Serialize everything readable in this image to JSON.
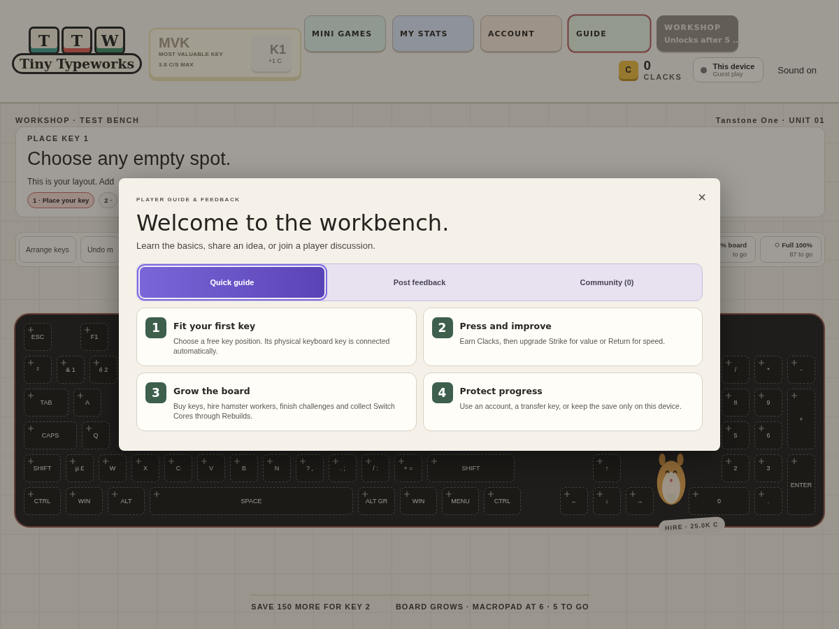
{
  "logo": {
    "keys": [
      "T",
      "T",
      "W"
    ],
    "name": "Tiny Typeworks"
  },
  "mvk": {
    "title": "MVK",
    "subtitle": "MOST VALUABLE KEY",
    "rate": "3.8 C/S MAX",
    "key": "K1",
    "key_value": "+1 C"
  },
  "nav": [
    {
      "label": "MINI GAMES",
      "selected": false,
      "disabled": false
    },
    {
      "label": "MY STATS",
      "selected": false,
      "disabled": false
    },
    {
      "label": "ACCOUNT",
      "selected": false,
      "disabled": false
    },
    {
      "label": "GUIDE",
      "selected": true,
      "disabled": false
    },
    {
      "label": "WORKSHOP",
      "sublabel": "Unlocks after 5 ...",
      "selected": false,
      "disabled": true
    }
  ],
  "status": {
    "coin": "C",
    "clacks": "0",
    "clacks_label": "CLACKS",
    "device": "This device",
    "device_sub": "Guest play",
    "sound": "Sound on"
  },
  "bench": {
    "left_label": "WORKSHOP · TEST BENCH",
    "right_label": "Tanstone One · UNIT 01"
  },
  "place_card": {
    "eyebrow": "PLACE KEY 1",
    "heading": "Choose any empty spot.",
    "text": "This is your layout. Add",
    "steps": [
      {
        "label": "1 · Place your key",
        "selected": true
      },
      {
        "label": "2 ·",
        "selected": false
      }
    ]
  },
  "toolbar": {
    "buttons": [
      "Arrange keys",
      "Undo m"
    ],
    "goals": [
      {
        "title": "% board",
        "sub": "to go"
      },
      {
        "title": "Full 100%",
        "sub": "87 to go",
        "icon": true
      }
    ]
  },
  "keyboard": {
    "rows": [
      {
        "main": [
          {
            "label": "ESC",
            "kind": "esc"
          },
          {
            "label": "F1",
            "kind": "key"
          }
        ],
        "nav": [],
        "pad": []
      },
      {
        "main": [
          {
            "label": "²",
            "kind": "key"
          },
          {
            "label": "& 1",
            "kind": "key"
          },
          {
            "label": "é 2",
            "kind": "key"
          }
        ],
        "nav": [],
        "pad": [
          {
            "label": "/",
            "kind": "key"
          },
          {
            "label": "*",
            "kind": "key"
          },
          {
            "label": "-",
            "kind": "key"
          }
        ]
      },
      {
        "main": [
          {
            "label": "TAB",
            "kind": "tab"
          },
          {
            "label": "A",
            "kind": "key"
          }
        ],
        "nav": [],
        "pad": [
          {
            "label": "8",
            "kind": "key"
          },
          {
            "label": "9",
            "kind": "key"
          },
          {
            "label": "+",
            "kind": "tall"
          }
        ]
      },
      {
        "main": [
          {
            "label": "CAPS",
            "kind": "caps"
          },
          {
            "label": "Q",
            "kind": "key"
          }
        ],
        "nav": [],
        "pad": [
          {
            "label": "5",
            "kind": "key"
          },
          {
            "label": "6",
            "kind": "key"
          }
        ]
      },
      {
        "main": [
          {
            "label": "SHIFT",
            "kind": "mod"
          },
          {
            "label": "µ £",
            "kind": "key"
          },
          {
            "label": "W",
            "kind": "key"
          },
          {
            "label": "X",
            "kind": "key"
          },
          {
            "label": "C",
            "kind": "key"
          },
          {
            "label": "V",
            "kind": "key"
          },
          {
            "label": "B",
            "kind": "key"
          },
          {
            "label": "N",
            "kind": "key"
          },
          {
            "label": "? ,",
            "kind": "key"
          },
          {
            "label": ". ;",
            "kind": "key"
          },
          {
            "label": "/ :",
            "kind": "key"
          },
          {
            "label": "+ =",
            "kind": "key"
          },
          {
            "label": "SHIFT",
            "kind": "shift"
          }
        ],
        "nav": [
          {
            "label": "↑",
            "kind": "key"
          }
        ],
        "pad": [
          {
            "label": "2",
            "kind": "key"
          },
          {
            "label": "3",
            "kind": "key"
          },
          {
            "label": "ENTER",
            "kind": "tall"
          }
        ]
      },
      {
        "main": [
          {
            "label": "CTRL",
            "kind": "mod"
          },
          {
            "label": "WIN",
            "kind": "mod"
          },
          {
            "label": "ALT",
            "kind": "mod"
          },
          {
            "label": "SPACE",
            "kind": "space"
          },
          {
            "label": "ALT GR",
            "kind": "mod"
          },
          {
            "label": "WIN",
            "kind": "mod"
          },
          {
            "label": "MENU",
            "kind": "mod"
          },
          {
            "label": "CTRL",
            "kind": "mod"
          }
        ],
        "nav": [
          {
            "label": "←",
            "kind": "key"
          },
          {
            "label": "↓",
            "kind": "key"
          },
          {
            "label": "→",
            "kind": "key"
          }
        ],
        "pad": [
          {
            "label": "0",
            "kind": "double"
          },
          {
            "label": ".",
            "kind": "key"
          }
        ]
      }
    ],
    "hire": "HIRE · 25.0K C"
  },
  "footer": [
    "SAVE 150 MORE FOR KEY 2",
    "BOARD GROWS · MACROPAD AT 6 · 5 TO GO"
  ],
  "modal": {
    "eyebrow": "PLAYER GUIDE & FEEDBACK",
    "close": "×",
    "title": "Welcome to the workbench.",
    "subtitle": "Learn the basics, share an idea, or join a player discussion.",
    "tabs": [
      {
        "label": "Quick guide",
        "selected": true
      },
      {
        "label": "Post feedback",
        "selected": false
      },
      {
        "label": "Community (0)",
        "selected": false
      }
    ],
    "cards": [
      {
        "number": "1",
        "title": "Fit your first key",
        "text": "Choose a free key position. Its physical keyboard key is connected automatically."
      },
      {
        "number": "2",
        "title": "Press and improve",
        "text": "Earn Clacks, then upgrade Strike for value or Return for speed."
      },
      {
        "number": "3",
        "title": "Grow the board",
        "text": "Buy keys, hire hamster workers, finish challenges and collect Switch Cores through Rebuilds."
      },
      {
        "number": "4",
        "title": "Protect progress",
        "text": "Use an account, a transfer key, or keep the save only on this device."
      }
    ]
  }
}
